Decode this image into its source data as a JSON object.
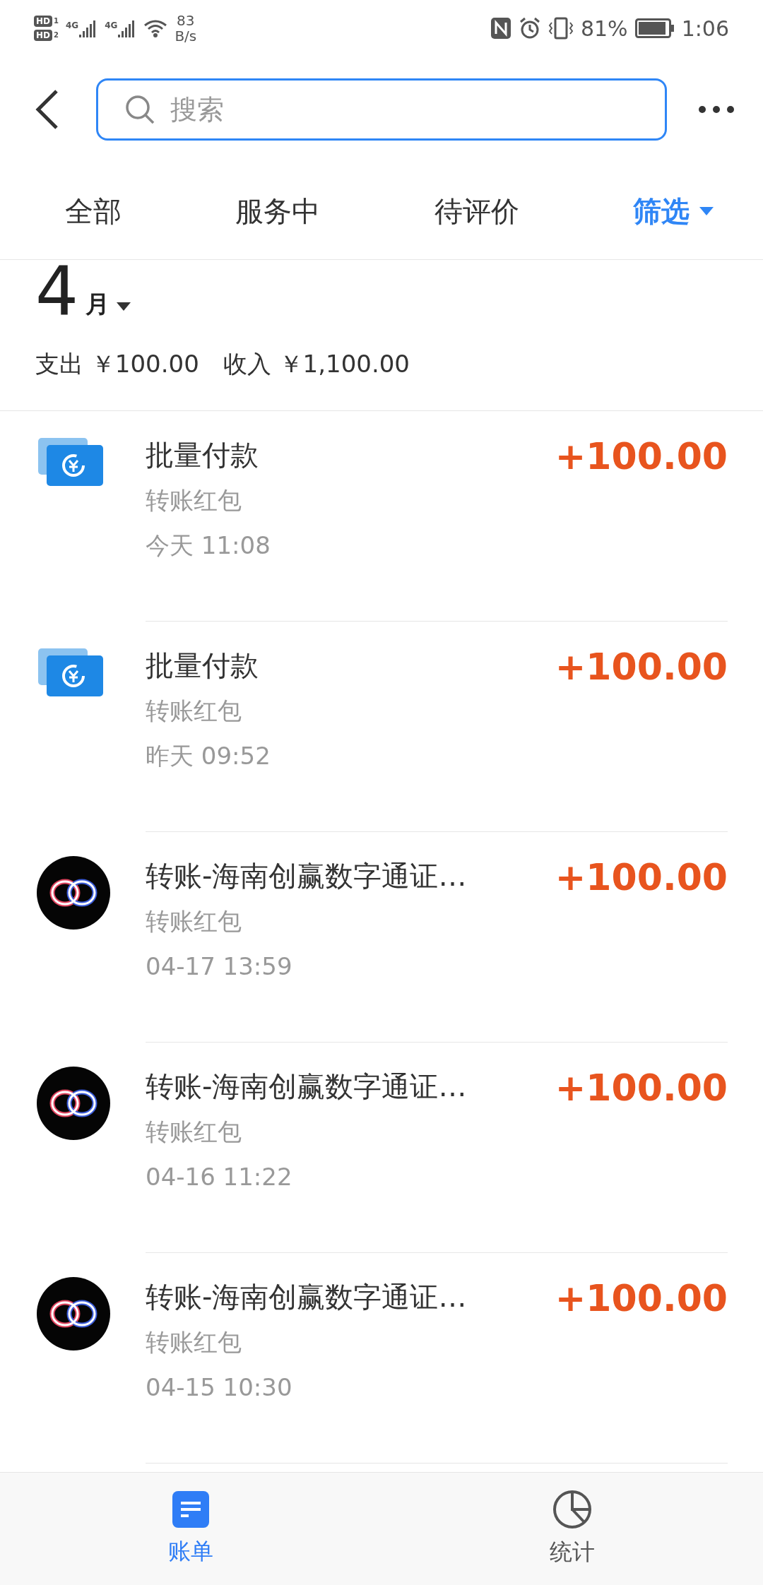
{
  "status_bar": {
    "sims": [
      {
        "badge": "HD",
        "slot": "1",
        "network": "4G"
      },
      {
        "badge": "HD",
        "slot": "2",
        "network": "4G"
      }
    ],
    "speed_value": "83",
    "speed_unit": "B/s",
    "battery": "81%",
    "time": "1:06"
  },
  "search": {
    "placeholder": "搜索"
  },
  "tabs": [
    {
      "label": "全部",
      "kind": "tab"
    },
    {
      "label": "服务中",
      "kind": "tab"
    },
    {
      "label": "待评价",
      "kind": "tab"
    },
    {
      "label": "筛选",
      "kind": "filter"
    }
  ],
  "month": {
    "number": "4",
    "unit": "月"
  },
  "summary": [
    {
      "label": "支出",
      "amount": "￥100.00"
    },
    {
      "label": "收入",
      "amount": "￥1,100.00"
    }
  ],
  "transactions": [
    {
      "kind": "batch",
      "title": "批量付款",
      "category": "转账红包",
      "day": "今天",
      "time": "11:08",
      "amount": "+100.00"
    },
    {
      "kind": "batch",
      "title": "批量付款",
      "category": "转账红包",
      "day": "昨天",
      "time": "09:52",
      "amount": "+100.00"
    },
    {
      "kind": "transfer",
      "title": "转账-海南创赢数字通证…",
      "category": "转账红包",
      "day": "04-17",
      "time": "13:59",
      "amount": "+100.00"
    },
    {
      "kind": "transfer",
      "title": "转账-海南创赢数字通证…",
      "category": "转账红包",
      "day": "04-16",
      "time": "11:22",
      "amount": "+100.00"
    },
    {
      "kind": "transfer",
      "title": "转账-海南创赢数字通证…",
      "category": "转账红包",
      "day": "04-15",
      "time": "10:30",
      "amount": "+100.00"
    }
  ],
  "bottom_nav": [
    {
      "label": "账单",
      "kind": "bills",
      "selected": true
    },
    {
      "label": "统计",
      "kind": "stats",
      "selected": false
    }
  ]
}
